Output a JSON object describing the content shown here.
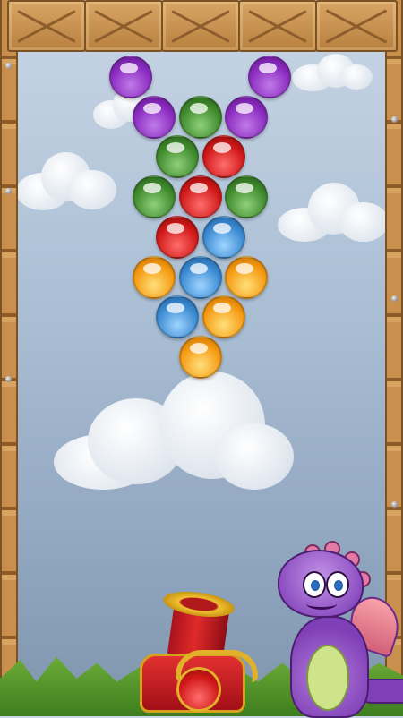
{
  "game": {
    "name": "",
    "projectile": {
      "color": "red"
    }
  },
  "bubbles": {
    "row1": [
      "purple",
      "purple"
    ],
    "row2": [
      "purple",
      "green",
      "purple"
    ],
    "row3": [
      "green",
      "red"
    ],
    "row4": [
      "green",
      "red",
      "green"
    ],
    "row5": [
      "red",
      "blue"
    ],
    "row6": [
      "orange",
      "blue",
      "orange"
    ],
    "row7": [
      "blue",
      "orange"
    ],
    "row8": [
      "orange"
    ]
  },
  "colors": {
    "purple": "#8a2bc0",
    "green": "#3f8a2c",
    "red": "#d11818",
    "blue": "#3a8ad2",
    "orange": "#f59a12",
    "sky": "#a9bdd3",
    "wood": "#c98f4c"
  },
  "icons": {
    "shooter": "cannon-icon",
    "mascot": "dragon-icon"
  }
}
